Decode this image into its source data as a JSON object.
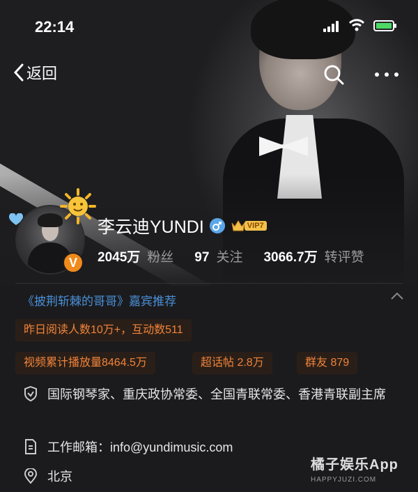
{
  "status_bar": {
    "time": "22:14"
  },
  "nav": {
    "back_label": "返回"
  },
  "profile": {
    "name": "李云迪YUNDI",
    "vip_level": "VIP7",
    "stats": [
      {
        "value": "2045万",
        "label": "粉丝"
      },
      {
        "value": "97",
        "label": "关注"
      },
      {
        "value": "3066.7万",
        "label": "转评赞"
      }
    ]
  },
  "show_recommend": "《披荆斩棘的哥哥》嘉宾推荐",
  "read_tag": "昨日阅读人数10万+，互动数511",
  "pills": [
    "视频累计播放量8464.5万",
    "超话帖 2.8万",
    "群友 879"
  ],
  "info": {
    "title": "国际钢琴家、重庆政协常委、全国青联常委、香港青联副主席",
    "email": "工作邮箱：info@yundimusic.com",
    "location": "北京"
  },
  "watermark": {
    "title": "橘子娱乐App",
    "sub": "HAPPYJUZI.COM"
  },
  "colors": {
    "accent_orange": "#f0833a",
    "link_blue": "#4a90d9",
    "battery_green": "#4cd964"
  },
  "icons": [
    "shield-icon",
    "document-icon",
    "location-pin-icon",
    "search-icon",
    "more-icon",
    "chevron-up-icon",
    "back-chevron-icon",
    "male-icon",
    "sun-icon",
    "heart-icon",
    "vip-crown-icon"
  ]
}
